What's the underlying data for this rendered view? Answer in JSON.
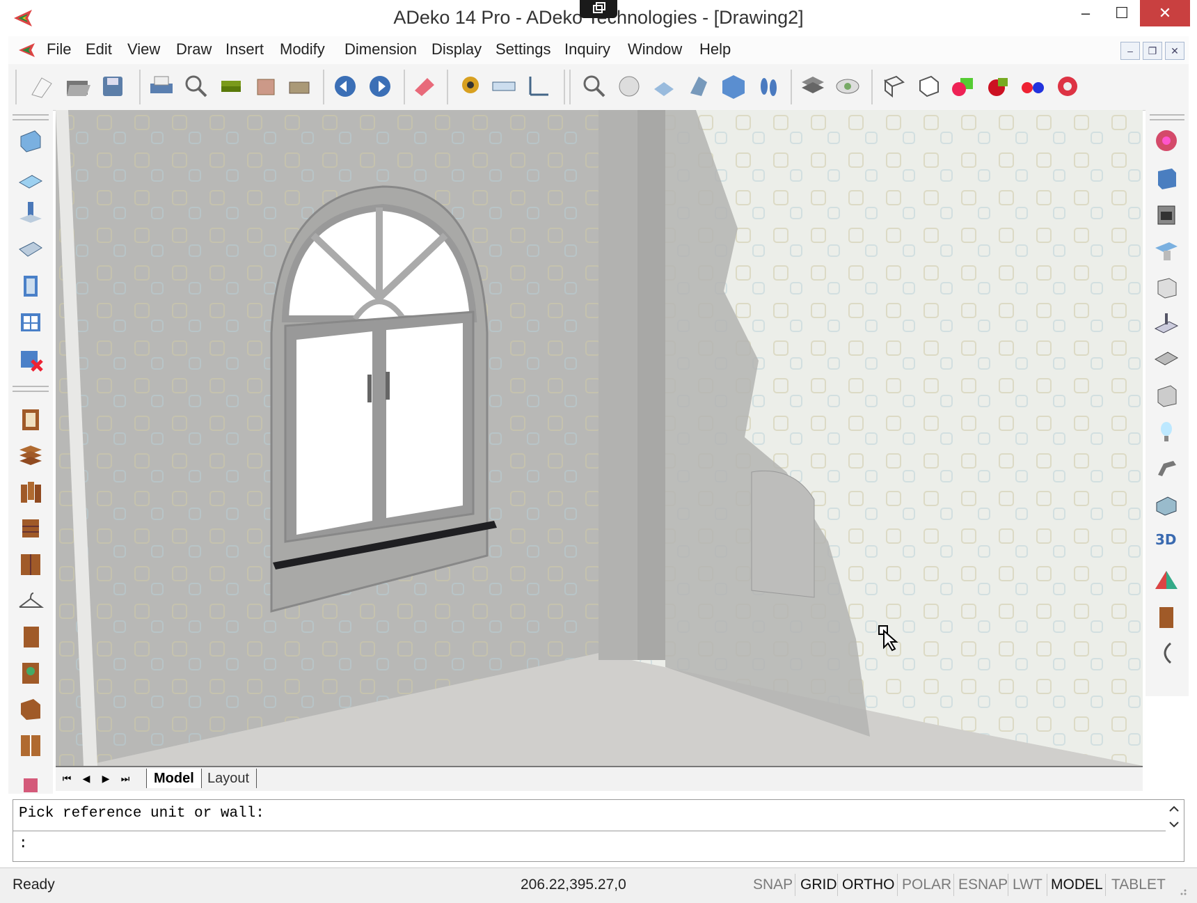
{
  "window": {
    "title": "ADeko 14 Pro  - ADeko Technologies - [Drawing2]",
    "controls": {
      "minimize": "–",
      "maximize": "☐",
      "close": "✕"
    }
  },
  "menubar": {
    "items": [
      "File",
      "Edit",
      "View",
      "Draw",
      "Insert",
      "Modify",
      "Dimension",
      "Display",
      "Settings",
      "Inquiry",
      "Window",
      "Help"
    ],
    "mdi_controls": {
      "minimize": "–",
      "restore": "❐",
      "close": "✕"
    }
  },
  "toolbar": {
    "icons": [
      "new-file-icon",
      "open-folder-icon",
      "save-icon",
      "print-icon",
      "print-preview-icon",
      "stack-icon",
      "properties-icon",
      "plot-icon",
      "undo-icon",
      "redo-icon",
      "eraser-icon",
      "measure-tape-icon",
      "ruler-icon",
      "dimension-icon",
      "zoom-icon",
      "numbered-view-icon",
      "floor-view-icon",
      "wall-view-icon",
      "cube-view-icon",
      "footprints-icon",
      "layers-icon",
      "eye-icon",
      "wireframe-cube-icon",
      "hidden-cube-icon",
      "green-ball-icon",
      "red-ball-icon",
      "glasses-icon",
      "render-icon"
    ]
  },
  "left_sidebar": {
    "group1": [
      "wall-icon",
      "floor-icon",
      "column-icon",
      "slab-icon",
      "door-icon",
      "window-icon",
      "delete-window-icon"
    ],
    "group2": [
      "cabinet-icon",
      "shelves-icon",
      "drawers-icon",
      "box-icon",
      "wardrobe-icon",
      "hanger-icon",
      "panel-icon",
      "appliance-icon",
      "corner-cabinet-icon",
      "double-door-icon",
      "misc-icon"
    ]
  },
  "right_sidebar": {
    "icons": [
      "sink-icon",
      "cube-icon",
      "oven-icon",
      "hood-icon",
      "base-unit-icon",
      "counter-icon",
      "tray-icon",
      "block-icon",
      "lamp-icon",
      "faucet-icon",
      "box-3d-icon",
      "3d-text-icon",
      "pyramid-icon",
      "door-panel-icon",
      "curve-icon"
    ]
  },
  "tabs": {
    "nav": [
      "⏮",
      "◀",
      "▶",
      "⏭"
    ],
    "items": [
      {
        "label": "Model",
        "active": true
      },
      {
        "label": "Layout",
        "active": false
      }
    ]
  },
  "command": {
    "prompt": "Pick reference unit or wall:",
    "input": ":"
  },
  "statusbar": {
    "state": "Ready",
    "coordinates": "206.22,395.27,0",
    "toggles": [
      {
        "label": "SNAP",
        "on": false
      },
      {
        "label": "GRID",
        "on": true
      },
      {
        "label": "ORTHO",
        "on": true
      },
      {
        "label": "POLAR",
        "on": false
      },
      {
        "label": "ESNAP",
        "on": false
      },
      {
        "label": "LWT",
        "on": false
      },
      {
        "label": "MODEL",
        "on": true
      },
      {
        "label": "TABLET",
        "on": false
      }
    ]
  },
  "colors": {
    "close_button": "#c94040",
    "wall": "#b9b9b7",
    "right_wall": "#eef0ec",
    "floor": "#d4d3d0"
  }
}
